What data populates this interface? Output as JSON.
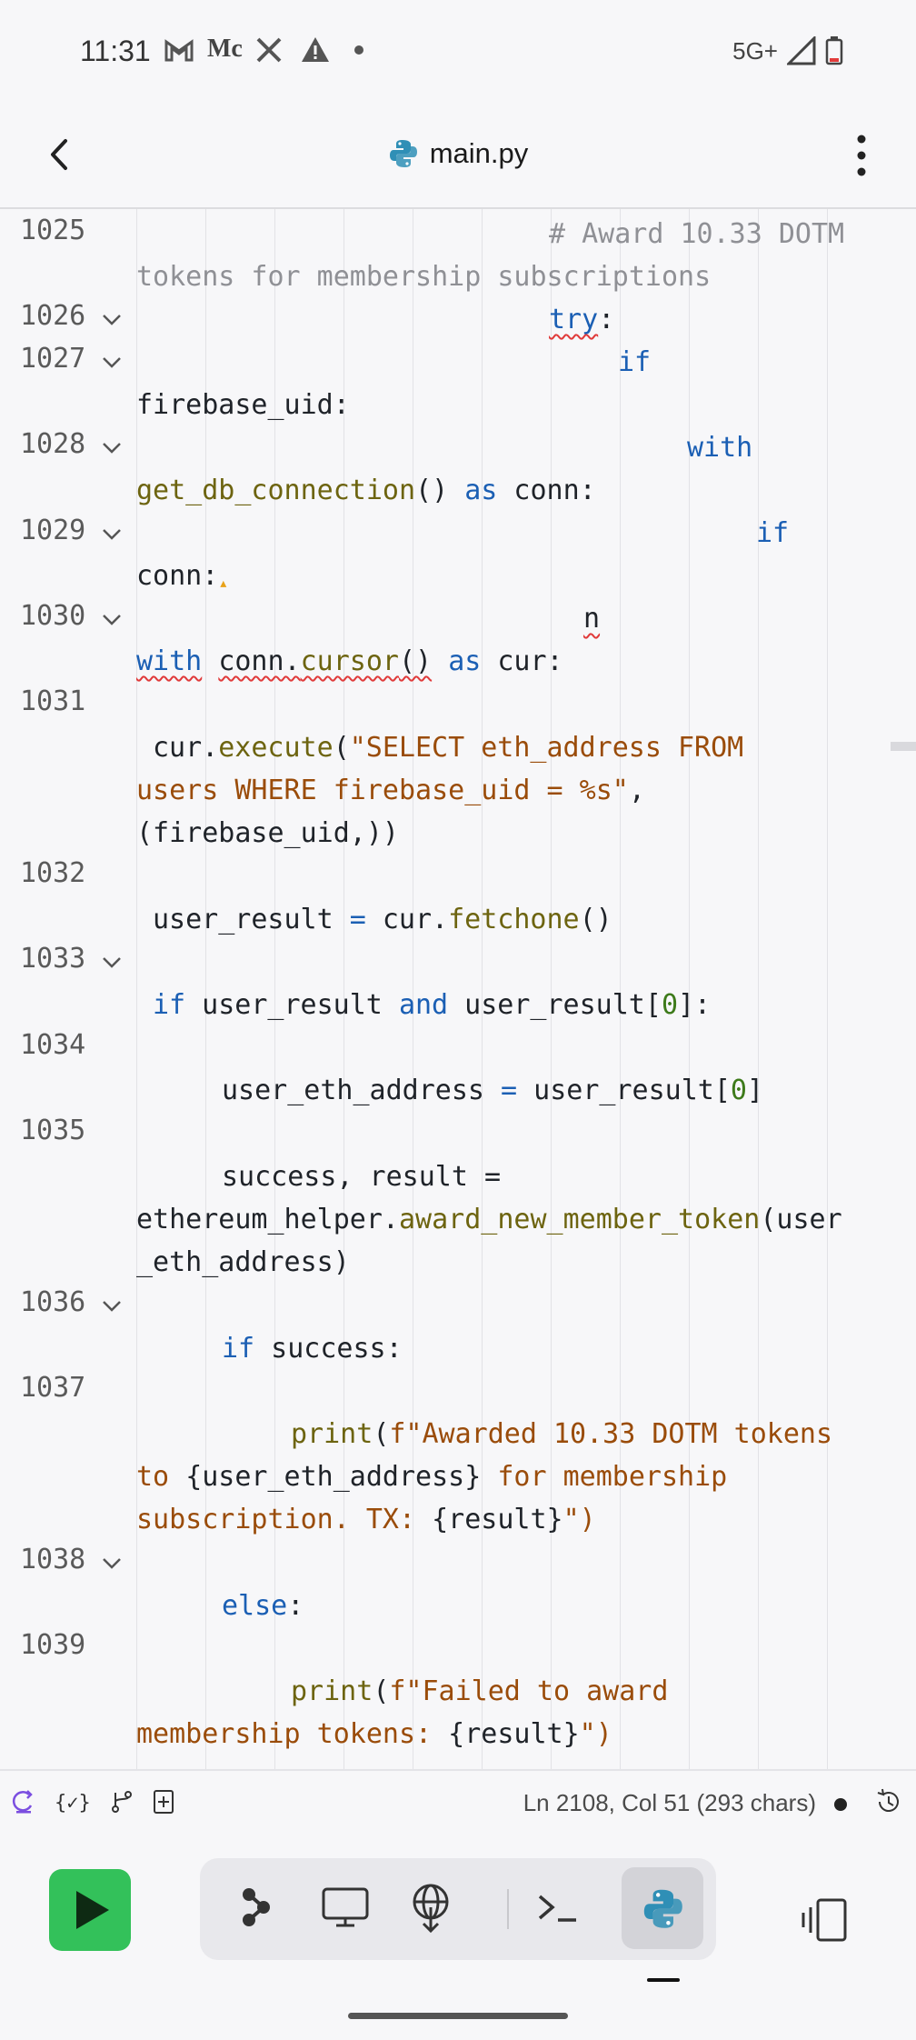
{
  "status_bar": {
    "time": "11:31",
    "network": "5G+"
  },
  "header": {
    "file_name": "main.py"
  },
  "editor": {
    "lines": [
      {
        "num": "1025",
        "fold": false
      },
      {
        "num": "1026",
        "fold": true
      },
      {
        "num": "1027",
        "fold": true
      },
      {
        "num": "1028",
        "fold": true
      },
      {
        "num": "1029",
        "fold": true
      },
      {
        "num": "1030",
        "fold": true
      },
      {
        "num": "1031",
        "fold": false
      },
      {
        "num": "1032",
        "fold": false
      },
      {
        "num": "1033",
        "fold": true
      },
      {
        "num": "1034",
        "fold": false
      },
      {
        "num": "1035",
        "fold": false
      },
      {
        "num": "1036",
        "fold": true
      },
      {
        "num": "1037",
        "fold": false
      },
      {
        "num": "1038",
        "fold": true
      },
      {
        "num": "1039",
        "fold": false
      }
    ],
    "code": {
      "l1025a": "# Award 10.33 DOTM",
      "l1025b": "tokens for membership subscriptions",
      "l1026": "try",
      "l1027a": "if",
      "l1027b": "firebase_uid:",
      "l1028a": "with",
      "l1028b_fn": "get_db_connection",
      "l1028b_rest": "() ",
      "l1028b_kw": "as",
      "l1028b_end": " conn:",
      "l1029a": "if",
      "l1029b": "conn:",
      "l1030a": "n",
      "l1030b_kw": "with",
      "l1030b_obj": "conn.",
      "l1030b_fn": "cursor",
      "l1030b_paren": "()",
      "l1030b_as": "as",
      "l1030b_end": " cur:",
      "l1031_obj": "cur.",
      "l1031_fn": "execute",
      "l1031_str1": "\"SELECT eth_address FROM",
      "l1031_str2": "users WHERE firebase_uid = %s\"",
      "l1031_end": "(firebase_uid,))",
      "l1032_var": "user_result ",
      "l1032_obj": "cur.",
      "l1032_fn": "fetchone",
      "l1033_if": "if",
      "l1033_mid": " user_result ",
      "l1033_and": "and",
      "l1033_rest": " user_result[",
      "l1033_num": "0",
      "l1033_end": "]:",
      "l1034_var": "user_eth_address ",
      "l1034_rest": " user_result[",
      "l1034_num": "0",
      "l1035_a": "success, result =",
      "l1035_obj": "ethereum_helper.",
      "l1035_fn": "award_new_member_token",
      "l1035_arg": "(user",
      "l1035_c": "_eth_address)",
      "l1036_if": "if",
      "l1036_rest": " success:",
      "l1037_fn": "print",
      "l1037_s1": "f\"Awarded 10.33 DOTM tokens",
      "l1037_s2a": "to ",
      "l1037_s2b": "{user_eth_address}",
      "l1037_s2c": " for membership",
      "l1037_s3a": "subscription. TX: ",
      "l1037_s3b": "{result}",
      "l1037_s3c": "\")",
      "l1038": "else",
      "l1039_fn": "print",
      "l1039_s1": "f\"Failed to award",
      "l1039_s2a": "membership tokens: ",
      "l1039_s2b": "{result}",
      "l1039_s2c": "\")"
    }
  },
  "status_row": {
    "position": "Ln 2108, Col 51 (293 chars)"
  },
  "colors": {
    "run": "#33c15a",
    "keyword": "#1b5fb4",
    "function": "#6d6410",
    "string": "#9a4c0a"
  }
}
